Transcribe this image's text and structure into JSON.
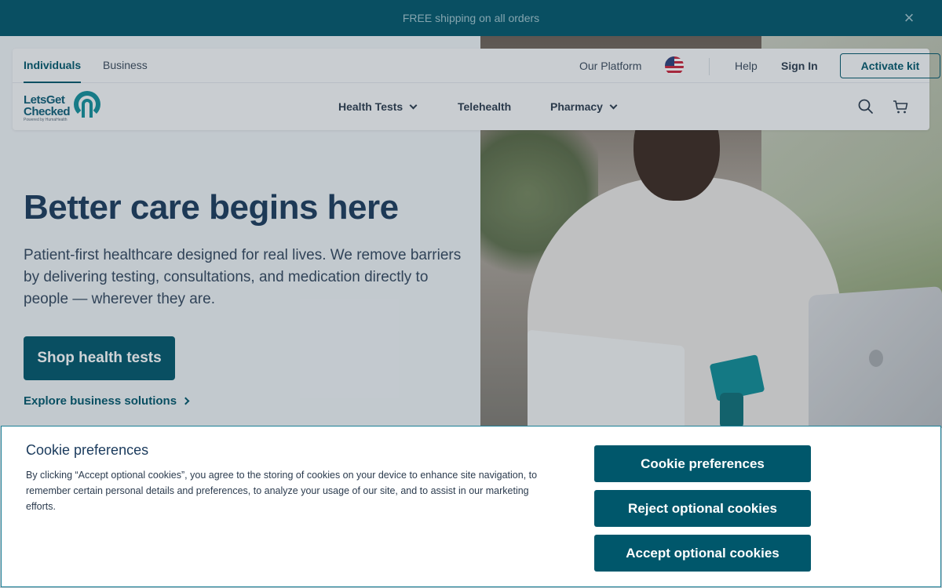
{
  "promo": {
    "text": "FREE shipping on all orders",
    "close_glyph": "×"
  },
  "nav": {
    "segments": [
      {
        "label": "Individuals",
        "active": true
      },
      {
        "label": "Business",
        "active": false
      }
    ],
    "top_links": {
      "platform": "Our Platform",
      "help": "Help",
      "sign_in": "Sign In",
      "activate": "Activate kit"
    },
    "locale_icon": "us-flag-icon",
    "logo": {
      "line1": "LetsGet",
      "line2": "Checked",
      "sub": "Powered by HumaHealth"
    },
    "main": {
      "health_tests": "Health Tests",
      "telehealth": "Telehealth",
      "pharmacy": "Pharmacy"
    },
    "icons": [
      "search-icon",
      "cart-icon"
    ]
  },
  "hero": {
    "title": "Better care begins here",
    "subtitle": "Patient-first healthcare designed for real lives. We remove barriers by delivering testing, consultations, and medication directly to people — wherever they are.",
    "cta": "Shop health tests",
    "secondary_link": "Explore business solutions"
  },
  "cookie": {
    "title": "Cookie preferences",
    "text": "By clicking “Accept optional cookies”, you agree to the storing of cookies on your device to enhance site navigation, to remember certain personal details and preferences, to analyze your usage of our site, and to assist in our marketing efforts.",
    "buttons": {
      "preferences": "Cookie preferences",
      "reject": "Reject optional cookies",
      "accept": "Accept optional cookies"
    }
  },
  "colors": {
    "brand": "#00576b",
    "logo_teal": "#138f9a",
    "heading": "#1a3a5c"
  }
}
